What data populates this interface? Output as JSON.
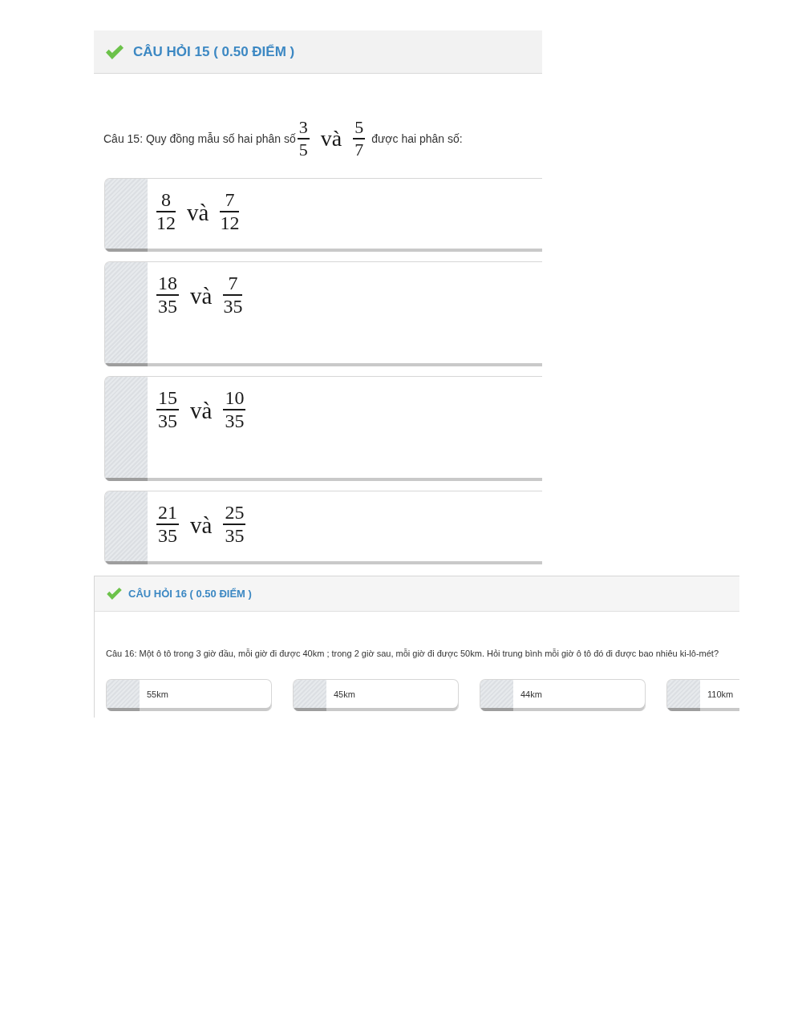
{
  "questions": [
    {
      "kind": "stacked",
      "title": "CÂU HỎI 15 ( 0.50 ĐIỂM )",
      "prompt": [
        {
          "kind": "text",
          "text": "Câu 15: Quy đồng mẫu số hai phân số"
        },
        {
          "kind": "fraction",
          "numerator": "3",
          "denominator": "5"
        },
        {
          "kind": "math_text",
          "text": "và"
        },
        {
          "kind": "fraction",
          "numerator": "5",
          "denominator": "7"
        },
        {
          "kind": "text",
          "text": "được hai phân số:"
        }
      ],
      "options": [
        {
          "selected": false,
          "content": [
            {
              "kind": "fraction",
              "numerator": "8",
              "denominator": "12"
            },
            {
              "kind": "math_text",
              "text": "và"
            },
            {
              "kind": "fraction",
              "numerator": "7",
              "denominator": "12"
            }
          ]
        },
        {
          "selected": false,
          "content": [
            {
              "kind": "fraction",
              "numerator": "18",
              "denominator": "35"
            },
            {
              "kind": "math_text",
              "text": "và"
            },
            {
              "kind": "fraction",
              "numerator": "7",
              "denominator": "35"
            }
          ]
        },
        {
          "selected": false,
          "content": [
            {
              "kind": "fraction",
              "numerator": "15",
              "denominator": "35"
            },
            {
              "kind": "math_text",
              "text": "và"
            },
            {
              "kind": "fraction",
              "numerator": "10",
              "denominator": "35"
            }
          ]
        },
        {
          "selected": false,
          "content": [
            {
              "kind": "fraction",
              "numerator": "21",
              "denominator": "35"
            },
            {
              "kind": "math_text",
              "text": "và"
            },
            {
              "kind": "fraction",
              "numerator": "25",
              "denominator": "35"
            }
          ]
        }
      ]
    },
    {
      "kind": "inline",
      "title": "CÂU HỎI 16 ( 0.50 ĐIỂM )",
      "prompt": [
        {
          "kind": "text",
          "text": "Câu 16: Một ô tô trong 3 giờ đầu, mỗi giờ đi được 40km ; trong 2 giờ sau, mỗi giờ đi được 50km. Hỏi trung bình mỗi giờ ô tô đó đi được bao nhiêu ki-lô-mét?"
        }
      ],
      "options": [
        {
          "selected": false,
          "content": [
            {
              "kind": "text",
              "text": "55km"
            }
          ]
        },
        {
          "selected": false,
          "content": [
            {
              "kind": "text",
              "text": "45km"
            }
          ]
        },
        {
          "selected": false,
          "content": [
            {
              "kind": "text",
              "text": "44km"
            }
          ]
        },
        {
          "selected": false,
          "content": [
            {
              "kind": "text",
              "text": "110km"
            }
          ]
        }
      ]
    }
  ]
}
